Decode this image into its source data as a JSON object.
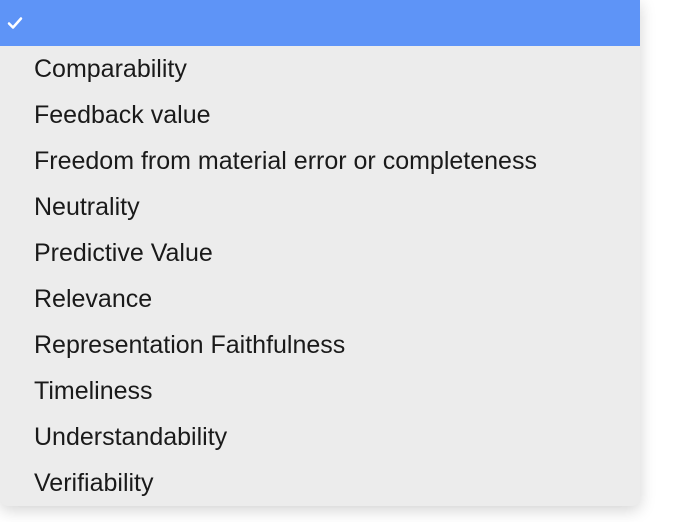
{
  "dropdown": {
    "selected_index": 0,
    "items": [
      {
        "label": ""
      },
      {
        "label": "Comparability"
      },
      {
        "label": "Feedback value"
      },
      {
        "label": "Freedom from material error or completeness"
      },
      {
        "label": "Neutrality"
      },
      {
        "label": "Predictive Value"
      },
      {
        "label": "Relevance"
      },
      {
        "label": "Representation Faithfulness"
      },
      {
        "label": "Timeliness"
      },
      {
        "label": "Understandability"
      },
      {
        "label": "Verifiability"
      }
    ]
  },
  "colors": {
    "highlight": "#5e94f7",
    "menu_bg": "#ececec"
  }
}
